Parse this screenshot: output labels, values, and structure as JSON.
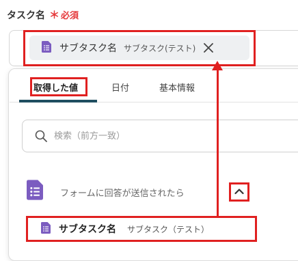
{
  "field": {
    "label": "タスク名",
    "required_mark": "＊",
    "required_text": "必須"
  },
  "chip": {
    "title": "サブタスク名",
    "subtitle": "サブタスク(テスト)",
    "icon": "document-icon",
    "close_icon": "close-icon"
  },
  "tabs": [
    {
      "label": "取得した値",
      "active": true
    },
    {
      "label": "日付",
      "active": false
    },
    {
      "label": "基本情報",
      "active": false
    }
  ],
  "search": {
    "placeholder": "検索（前方一致）",
    "value": ""
  },
  "section": {
    "label": "フォームに回答が送信されたら",
    "icon": "document-icon",
    "toggle_icon": "chevron-up-icon"
  },
  "result": {
    "title": "サブタスク名",
    "subtitle": "サブタスク（テスト）",
    "icon": "document-icon"
  },
  "colors": {
    "accent": "#1f4e60",
    "highlight": "#e02020",
    "required": "#e5393b",
    "doc_icon": "#7b5cc0"
  }
}
